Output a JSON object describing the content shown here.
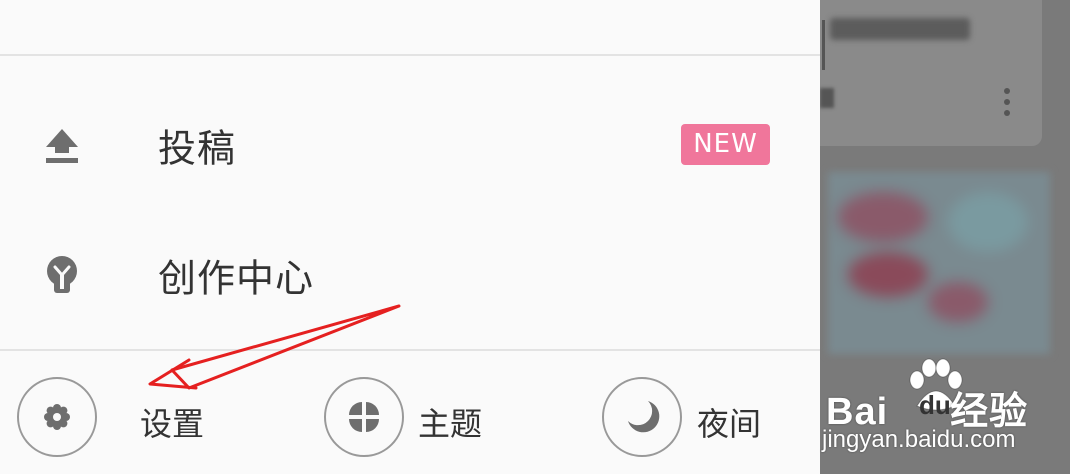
{
  "menu": {
    "submit_label": "投稿",
    "submit_badge": "NEW",
    "creator_label": "创作中心"
  },
  "bottom": {
    "settings_label": "设置",
    "theme_label": "主题",
    "night_label": "夜间"
  },
  "watermark": {
    "brand": "Bai",
    "brand_du": "du",
    "brand_suffix": "经验",
    "url": "jingyan.baidu.com"
  },
  "colors": {
    "badge": "#f0769b",
    "annotation_arrow": "#e52020"
  }
}
